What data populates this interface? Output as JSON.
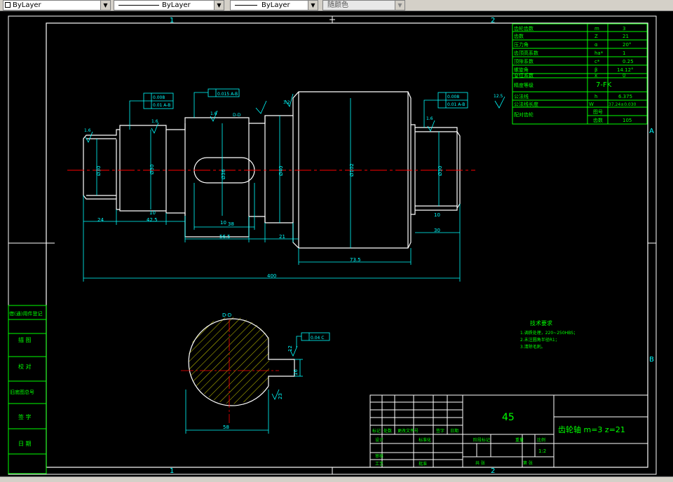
{
  "toolbar": {
    "color_value": "ByLayer",
    "linetype_value": "ByLayer",
    "lineweight_value": "ByLayer",
    "plotstyle_value": "随颜色"
  },
  "colors": {
    "background": "#000000",
    "frame": "#ffffff",
    "table": "#00ff00",
    "dimension": "#00ffff",
    "centerline": "#ff0000",
    "hatch": "#ffff00",
    "annotation": "#ffffff"
  },
  "zone_labels": {
    "top_1": "1",
    "top_2": "2",
    "bottom_1": "1",
    "bottom_2": "2",
    "right_a": "A",
    "right_b": "B"
  },
  "gear_params": {
    "rows": [
      {
        "label": "齿轮齿数",
        "sym": "m",
        "val": "3"
      },
      {
        "label": "齿数",
        "sym": "Z",
        "val": "21"
      },
      {
        "label": "压力角",
        "sym": "α",
        "val": "20°"
      },
      {
        "label": "齿顶高系数",
        "sym": "ha*",
        "val": "1"
      },
      {
        "label": "顶隙系数",
        "sym": "c*",
        "val": "0.25"
      },
      {
        "label": "螺旋角",
        "sym": "β",
        "val": "14.12°"
      },
      {
        "label": "变位系数",
        "sym": "x",
        "val": "0"
      },
      {
        "label": "精度等级",
        "sym": "",
        "val": "7-FK"
      },
      {
        "label": "公法线",
        "sym": "h",
        "val": "6.375"
      },
      {
        "label": "公法线长度",
        "sym": "W",
        "val": "37.24±0.030"
      },
      {
        "label": "配对齿轮",
        "sym": "图号",
        "val": ""
      },
      {
        "label": "",
        "sym": "齿数",
        "val": "105"
      }
    ]
  },
  "dims": {
    "d1": "Ø30",
    "d2": "Ø30",
    "d3": "Ø35",
    "d4": "Ø40",
    "d5": "Ø102",
    "d6": "Ø30",
    "keyway": "Ø36",
    "l1": "24",
    "l2": "42.5",
    "l3": "10",
    "l4": "38",
    "l5": "56.5",
    "l6": "21",
    "l7": "73.5",
    "l8": "30",
    "total": "400",
    "key_depth": "12",
    "section_width": "58",
    "section_depth": "16",
    "section_angle": "23",
    "runout_1": "0.008",
    "runout_2": "0.01 A-B",
    "sym_tol": "0.015 A-B",
    "runout_3": "0.008",
    "runout_4": "0.01 A-B",
    "section_tol": "0.04 C",
    "rough_16": "1.6",
    "rough_32": "3.2",
    "rough_125": "12.5",
    "section_label": "D-D"
  },
  "tech_req": {
    "title": "技术要求",
    "lines": [
      "1.调质处理，220~250HBS；",
      "2.未注圆角半径R1；",
      "3.清除毛刺。"
    ]
  },
  "side_panel": {
    "items": [
      "借(通)用件登记",
      "描 图",
      "校 对",
      "旧底图总号",
      "签 字",
      "日 期"
    ]
  },
  "title_block": {
    "material": "45",
    "part_name": "齿轮轴 m=3 z=21",
    "scale": "1:2",
    "label_mark": "标记",
    "label_count": "处数",
    "label_doc": "更改文件号",
    "label_sign": "签字",
    "label_date": "日期",
    "label_design": "设计",
    "label_std": "标准化",
    "label_stage": "阶段标记",
    "label_weight": "重量",
    "label_scale": "比例",
    "label_review": "审核",
    "label_process": "工艺",
    "label_approve": "批准",
    "label_sheets": "共 张",
    "label_sheet": "第 张"
  }
}
